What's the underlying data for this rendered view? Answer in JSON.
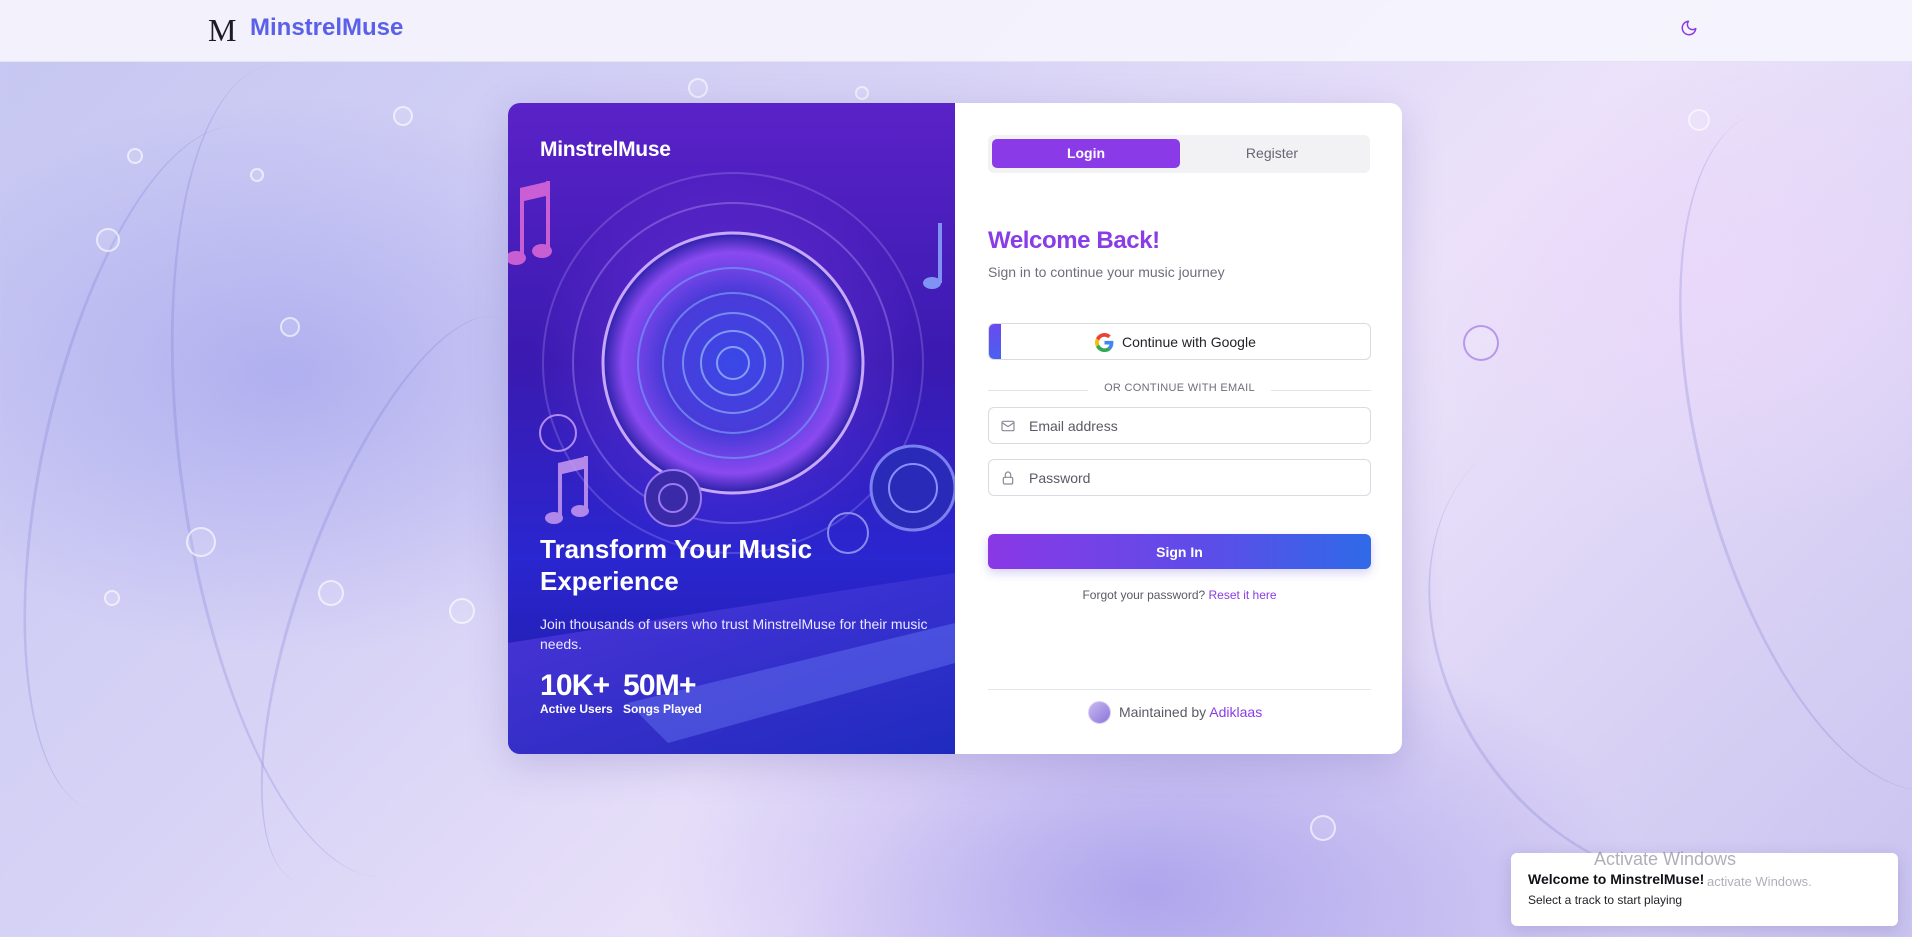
{
  "header": {
    "logo_letter": "M",
    "brand": "MinstrelMuse"
  },
  "hero": {
    "brand": "MinstrelMuse",
    "heading": "Transform Your Music Experience",
    "description": "Join thousands of users who trust MinstrelMuse for their music needs.",
    "stats": [
      {
        "value": "10K+",
        "label": "Active Users"
      },
      {
        "value": "50M+",
        "label": "Songs Played"
      }
    ]
  },
  "auth": {
    "tabs": [
      {
        "label": "Login",
        "active": true
      },
      {
        "label": "Register",
        "active": false
      }
    ],
    "title": "Welcome Back!",
    "subtitle": "Sign in to continue your music journey",
    "google_label": "Continue with Google",
    "divider": "OR CONTINUE WITH EMAIL",
    "email_placeholder": "Email address",
    "password_placeholder": "Password",
    "signin_label": "Sign In",
    "forgot_text": "Forgot your password?",
    "forgot_link": "Reset it here",
    "maintained_text": "Maintained by",
    "maintainer": "Adiklaas"
  },
  "toast": {
    "title": "Welcome to MinstrelMuse!",
    "description": "Select a track to start playing"
  },
  "watermark": {
    "title": "Activate Windows",
    "subtitle": "activate Windows."
  },
  "colors": {
    "accent": "#8a3ce6",
    "brand_blue": "#5b60e8",
    "button_gradient_end": "#2f6ae8"
  }
}
